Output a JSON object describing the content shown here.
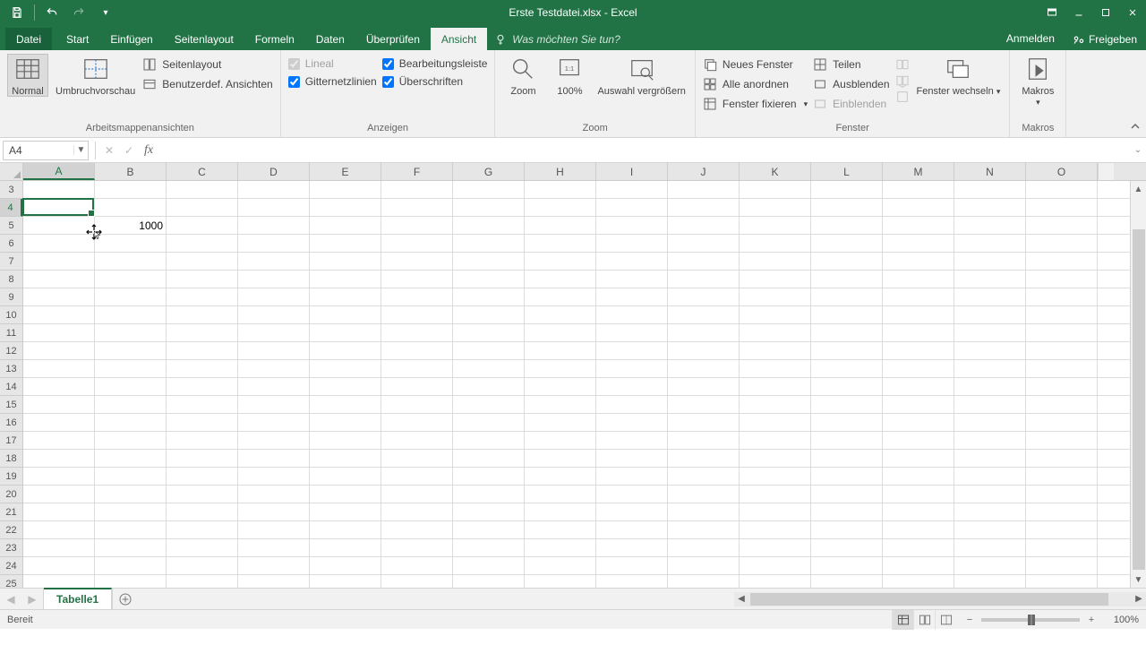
{
  "title": "Erste Testdatei.xlsx - Excel",
  "tabs": {
    "file": "Datei",
    "start": "Start",
    "insert": "Einfügen",
    "pagelayout": "Seitenlayout",
    "formulas": "Formeln",
    "data": "Daten",
    "review": "Überprüfen",
    "view": "Ansicht",
    "tell_placeholder": "Was möchten Sie tun?",
    "signin": "Anmelden",
    "share": "Freigeben"
  },
  "ribbon": {
    "groups": {
      "views": {
        "label": "Arbeitsmappenansichten",
        "normal": "Normal",
        "pagebreak": "Umbruchvorschau",
        "pagelayout": "Seitenlayout",
        "custom": "Benutzerdef. Ansichten"
      },
      "show": {
        "label": "Anzeigen",
        "ruler": "Lineal",
        "gridlines": "Gitternetzlinien",
        "formula_bar": "Bearbeitungsleiste",
        "headings": "Überschriften"
      },
      "zoom": {
        "label": "Zoom",
        "zoom": "Zoom",
        "hundred": "100%",
        "selection": "Auswahl vergrößern"
      },
      "window": {
        "label": "Fenster",
        "new_window": "Neues Fenster",
        "arrange": "Alle anordnen",
        "freeze": "Fenster fixieren",
        "split": "Teilen",
        "hide": "Ausblenden",
        "unhide": "Einblenden",
        "switch": "Fenster wechseln"
      },
      "macros": {
        "label": "Makros",
        "macros": "Makros"
      }
    }
  },
  "name_box": "A4",
  "formula_value": "",
  "columns": [
    "A",
    "B",
    "C",
    "D",
    "E",
    "F",
    "G",
    "H",
    "I",
    "J",
    "K",
    "L",
    "M",
    "N",
    "O"
  ],
  "first_row": 3,
  "row_count": 23,
  "cells": {
    "B5": "1000"
  },
  "selected_cell": "A4",
  "sheet": {
    "active": "Tabelle1"
  },
  "status": {
    "ready": "Bereit",
    "zoom": "100%"
  },
  "colors": {
    "accent": "#217346"
  }
}
